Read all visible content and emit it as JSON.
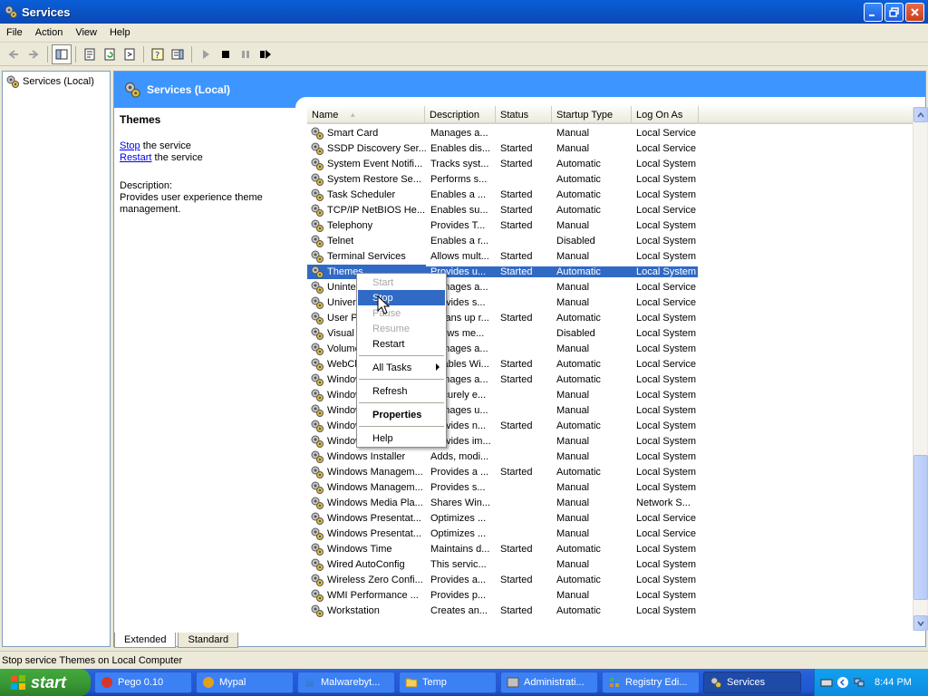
{
  "window": {
    "title": "Services"
  },
  "menubar": [
    "File",
    "Action",
    "View",
    "Help"
  ],
  "tree": {
    "root": "Services (Local)"
  },
  "banner": {
    "title": "Services (Local)"
  },
  "detail": {
    "heading": "Themes",
    "stop_link": "Stop",
    "stop_suffix": " the service",
    "restart_link": "Restart",
    "restart_suffix": " the service",
    "desc_label": "Description:",
    "desc_text": "Provides user experience theme management."
  },
  "columns": [
    "Name",
    "Description",
    "Status",
    "Startup Type",
    "Log On As"
  ],
  "rows": [
    [
      "Smart Card",
      "Manages a...",
      "",
      "Manual",
      "Local Service"
    ],
    [
      "SSDP Discovery Ser...",
      "Enables dis...",
      "Started",
      "Manual",
      "Local Service"
    ],
    [
      "System Event Notifi...",
      "Tracks syst...",
      "Started",
      "Automatic",
      "Local System"
    ],
    [
      "System Restore Se...",
      "Performs s...",
      "",
      "Automatic",
      "Local System"
    ],
    [
      "Task Scheduler",
      "Enables a ...",
      "Started",
      "Automatic",
      "Local System"
    ],
    [
      "TCP/IP NetBIOS He...",
      "Enables su...",
      "Started",
      "Automatic",
      "Local Service"
    ],
    [
      "Telephony",
      "Provides T...",
      "Started",
      "Manual",
      "Local System"
    ],
    [
      "Telnet",
      "Enables a r...",
      "",
      "Disabled",
      "Local System"
    ],
    [
      "Terminal Services",
      "Allows mult...",
      "Started",
      "Manual",
      "Local System"
    ],
    [
      "Themes",
      "Provides u...",
      "Started",
      "Automatic",
      "Local System"
    ],
    [
      "Uninterruptible...",
      "Manages a...",
      "",
      "Manual",
      "Local Service"
    ],
    [
      "Universal Plug...",
      "Provides s...",
      "",
      "Manual",
      "Local Service"
    ],
    [
      "User Profile...",
      "Cleans up r...",
      "Started",
      "Automatic",
      "Local System"
    ],
    [
      "Visual Studio...",
      "Allows me...",
      "",
      "Disabled",
      "Local System"
    ],
    [
      "Volume Shadow...",
      "Manages a...",
      "",
      "Manual",
      "Local System"
    ],
    [
      "WebClient",
      "Enables Wi...",
      "Started",
      "Automatic",
      "Local Service"
    ],
    [
      "Windows Audio",
      "Manages a...",
      "Started",
      "Automatic",
      "Local System"
    ],
    [
      "Windows CardSpace",
      "Securely e...",
      "",
      "Manual",
      "Local System"
    ],
    [
      "Windows Driver...",
      "Manages u...",
      "",
      "Manual",
      "Local System"
    ],
    [
      "Windows Firewall...",
      "Provides n...",
      "Started",
      "Automatic",
      "Local System"
    ],
    [
      "Windows Image...",
      "Provides im...",
      "",
      "Manual",
      "Local System"
    ],
    [
      "Windows Installer",
      "Adds, modi...",
      "",
      "Manual",
      "Local System"
    ],
    [
      "Windows Managem...",
      "Provides a ...",
      "Started",
      "Automatic",
      "Local System"
    ],
    [
      "Windows Managem...",
      "Provides s...",
      "",
      "Manual",
      "Local System"
    ],
    [
      "Windows Media Pla...",
      "Shares Win...",
      "",
      "Manual",
      "Network S..."
    ],
    [
      "Windows Presentat...",
      "Optimizes ...",
      "",
      "Manual",
      "Local Service"
    ],
    [
      "Windows Presentat...",
      "Optimizes ...",
      "",
      "Manual",
      "Local Service"
    ],
    [
      "Windows Time",
      "Maintains d...",
      "Started",
      "Automatic",
      "Local System"
    ],
    [
      "Wired AutoConfig",
      "This servic...",
      "",
      "Manual",
      "Local System"
    ],
    [
      "Wireless Zero Confi...",
      "Provides a...",
      "Started",
      "Automatic",
      "Local System"
    ],
    [
      "WMI Performance ...",
      "Provides p...",
      "",
      "Manual",
      "Local System"
    ],
    [
      "Workstation",
      "Creates an...",
      "Started",
      "Automatic",
      "Local System"
    ]
  ],
  "selected_row": "Themes",
  "context_menu": {
    "start": "Start",
    "stop": "Stop",
    "pause": "Pause",
    "resume": "Resume",
    "restart": "Restart",
    "all_tasks": "All Tasks",
    "refresh": "Refresh",
    "properties": "Properties",
    "help": "Help"
  },
  "tabs": [
    "Extended",
    "Standard"
  ],
  "statusbar": "Stop service Themes on Local Computer",
  "taskbar": {
    "start": "start",
    "tasks": [
      "Pego 0.10",
      "Mypal",
      "Malwarebyt...",
      "Temp",
      "Administrati...",
      "Registry Edi...",
      "Services"
    ],
    "clock": "8:44 PM"
  },
  "colors": {
    "selection": "#316ac5",
    "banner": "#3d95ff",
    "titlebar": "#0a5fd8"
  }
}
